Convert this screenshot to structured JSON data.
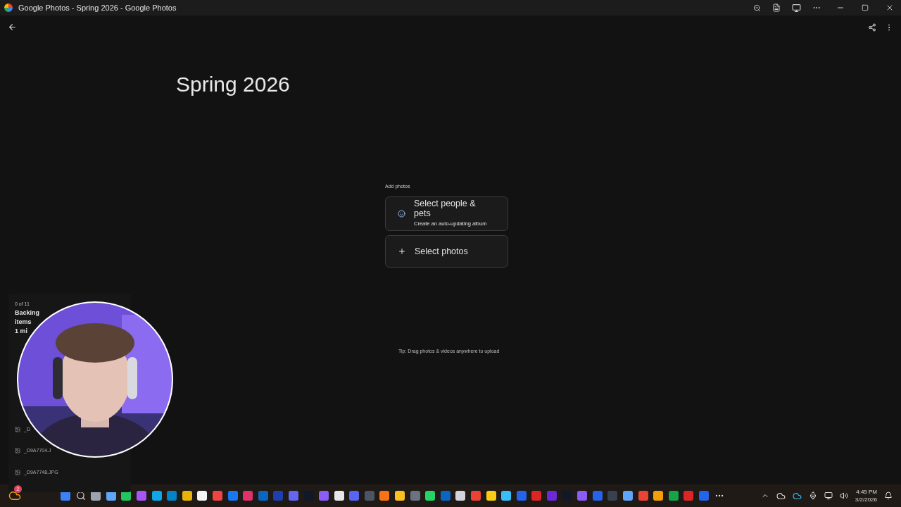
{
  "window": {
    "title": "Google Photos - Spring 2026 - Google Photos"
  },
  "album": {
    "title": "Spring 2026"
  },
  "add_photos": {
    "heading": "Add photos",
    "options": [
      {
        "kind": "people",
        "label": "Select people & pets",
        "sublabel": "Create an auto-updating album"
      },
      {
        "kind": "photos",
        "label": "Select photos"
      }
    ]
  },
  "tip": "Tip: Drag photos & videos anywhere to upload",
  "upload_panel": {
    "count": "0 of 11",
    "status_lines": [
      "Backing",
      "items",
      "1 mi"
    ],
    "files": [
      "_D",
      "_D9A7704.J",
      "_D9A7748.JPG"
    ]
  },
  "taskbar": {
    "weather_badge": "2",
    "time": "4:45 PM",
    "date": "3/2/2026"
  }
}
